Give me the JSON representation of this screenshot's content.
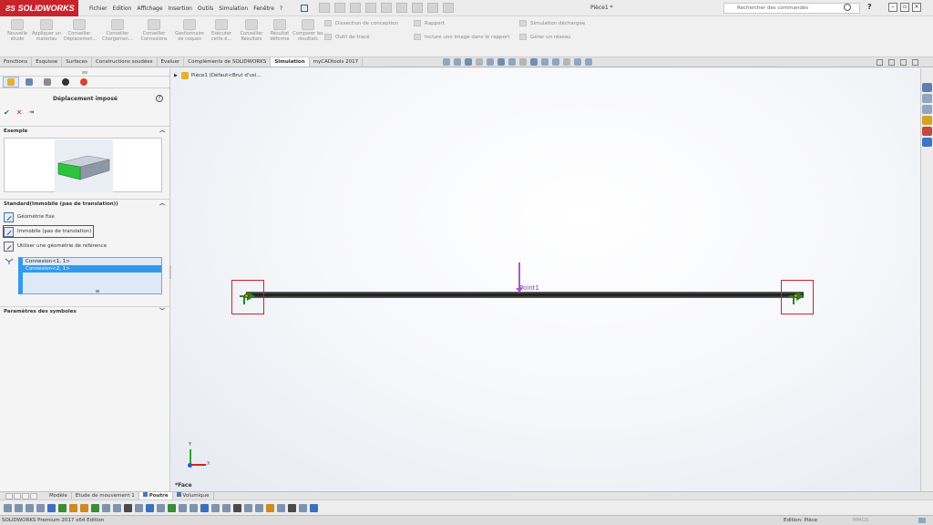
{
  "app": {
    "brand": "SOLIDWORKS",
    "document_title": "Pièce1 *",
    "menus": [
      "Fichier",
      "Edition",
      "Affichage",
      "Insertion",
      "Outils",
      "Simulation",
      "Fenêtre",
      "?"
    ],
    "search_placeholder": "Rechercher des commandes"
  },
  "command_manager": {
    "buttons": [
      {
        "label": "Nouvelle étude",
        "icon": "new-study-icon"
      },
      {
        "label": "Appliquer un matériau",
        "icon": "material-icon"
      },
      {
        "label": "Conseiller Déplacemen...",
        "icon": "fixture-advisor-icon"
      },
      {
        "label": "Conseiller Chargemen...",
        "icon": "load-advisor-icon"
      },
      {
        "label": "Conseiller Connexions",
        "icon": "connection-advisor-icon"
      },
      {
        "label": "Gestionnaire de coques",
        "icon": "shell-manager-icon"
      },
      {
        "label": "Exécuter cette é...",
        "icon": "run-icon"
      },
      {
        "label": "Conseiller Résultats",
        "icon": "results-advisor-icon"
      },
      {
        "label": "Résultat déformé",
        "icon": "deformed-result-icon"
      },
      {
        "label": "Comparer les résultats",
        "icon": "compare-results-icon"
      }
    ],
    "rows": [
      {
        "label": "Dissection de conception",
        "icon": "dissection-icon"
      },
      {
        "label": "Outil de tracé",
        "icon": "plot-tool-icon"
      },
      {
        "label": "Rapport",
        "icon": "report-icon"
      },
      {
        "label": "Inclure une image dans le rapport",
        "icon": "image-report-icon"
      },
      {
        "label": "Simulation déchargée",
        "icon": "unloaded-sim-icon"
      },
      {
        "label": "Gérer un réseau",
        "icon": "network-icon"
      }
    ]
  },
  "tabs": [
    "Fonctions",
    "Esquisse",
    "Surfaces",
    "Constructions soudées",
    "Evaluer",
    "Compléments de SOLIDWORKS",
    "Simulation",
    "myCADtools 2017"
  ],
  "active_tab": "Simulation",
  "property_manager": {
    "title": "Déplacement imposé",
    "help": "?",
    "ok": "✔",
    "cancel": "✕",
    "pin": "⇥",
    "example_header": "Exemple",
    "standard_header": "Standard(Immobile (pas de translation))",
    "options": [
      "Géométrie fixe",
      "Immobile (pas de translation)",
      "Utiliser une géométrie de référence"
    ],
    "selected_option": "Immobile (pas de translation)",
    "connections": [
      "Connexion<1, 1>",
      "Connexion<2, 1>"
    ],
    "symbol_params_header": "Paramètres des symboles",
    "chevron_up": "︿",
    "chevron_down": "﹀"
  },
  "graphics": {
    "tree_item": "Pièce1  (Défaut<Brut d'usi...",
    "load_label": "Point1",
    "axis_y": "Y",
    "axis_x": "X",
    "status": "*Face"
  },
  "bottom_tabs": [
    "Modèle",
    "Etude de mouvement 1",
    "Poutre",
    "Volumique"
  ],
  "active_bottom_tab": "Poutre",
  "statusbar": {
    "left": "SOLIDWORKS Premium 2017 x64 Edition",
    "mode": "Edition: Pièce",
    "units": "MMGS"
  },
  "colors": {
    "brand": "#c8232c",
    "fixture": "#1f8a25",
    "load": "#a55bd1",
    "selection": "#3399ee",
    "highlight": "#d0212a"
  }
}
